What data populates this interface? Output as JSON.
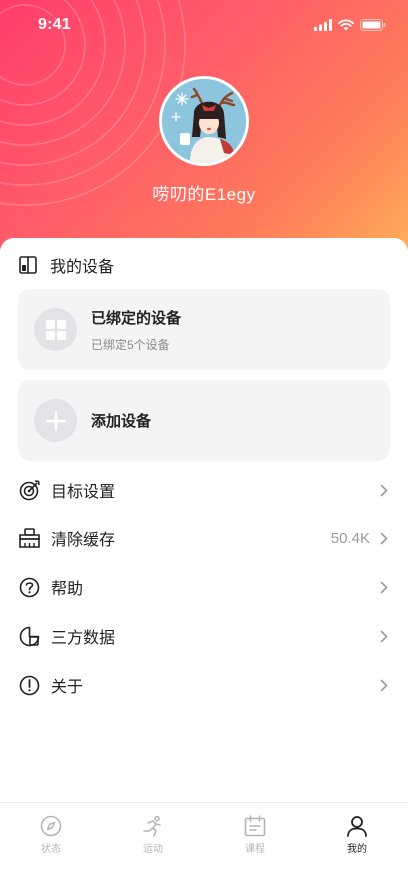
{
  "status_bar": {
    "time": "9:41"
  },
  "profile": {
    "username": "唠叨的E1egy"
  },
  "devices": {
    "section_title": "我的设备",
    "bound": {
      "title": "已绑定的设备",
      "subtitle": "已绑定5个设备"
    },
    "add": {
      "title": "添加设备"
    }
  },
  "menu": [
    {
      "label": "目标设置",
      "icon": "target-icon",
      "value": ""
    },
    {
      "label": "清除缓存",
      "icon": "broom-icon",
      "value": "50.4K"
    },
    {
      "label": "帮助",
      "icon": "question-icon",
      "value": ""
    },
    {
      "label": "三方数据",
      "icon": "data-share-icon",
      "value": ""
    },
    {
      "label": "关于",
      "icon": "info-icon",
      "value": ""
    }
  ],
  "tabbar": {
    "tabs": [
      {
        "label": "状态",
        "icon": "compass-icon",
        "active": false
      },
      {
        "label": "运动",
        "icon": "runner-icon",
        "active": false
      },
      {
        "label": "课程",
        "icon": "calendar-icon",
        "active": false
      },
      {
        "label": "我的",
        "icon": "person-icon",
        "active": true
      }
    ]
  },
  "colors": {
    "header_gradient": [
      "#ff3d6b",
      "#ffb25a"
    ],
    "card_bg": "#f3f4f6",
    "text_primary": "#222222",
    "text_secondary": "#8a8a8a",
    "tab_inactive": "#b5b5b5"
  }
}
